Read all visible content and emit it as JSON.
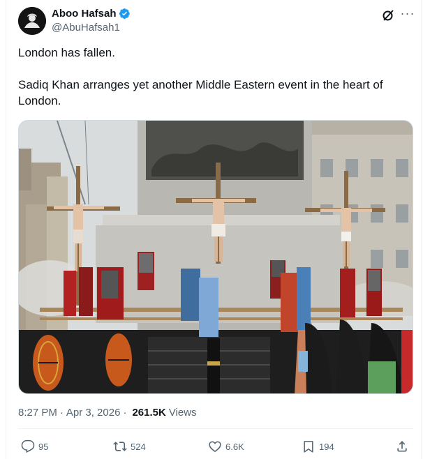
{
  "author": {
    "display_name": "Aboo Hafsah",
    "handle": "@AbuHafsah1",
    "verified": true,
    "avatar_icon": "avatar-silhouette"
  },
  "header_icons": {
    "grok": "grok-icon",
    "more": "more-icon",
    "more_glyph": "···"
  },
  "tweet": {
    "line1": "London has fallen.",
    "line2": "Sadiq Khan arranges yet another Middle Eastern event in the heart of London."
  },
  "media": {
    "type": "photo"
  },
  "meta": {
    "time": "8:27 PM",
    "date": "Apr 3, 2026",
    "separator": "·",
    "views_count": "261.5K",
    "views_label": "Views"
  },
  "actions": {
    "replies": "95",
    "reposts": "524",
    "likes": "6.6K",
    "bookmarks": "194"
  },
  "colors": {
    "text_primary": "#0f1419",
    "text_secondary": "#536471",
    "verified_blue": "#1d9bf0",
    "border": "#eff3f4"
  }
}
